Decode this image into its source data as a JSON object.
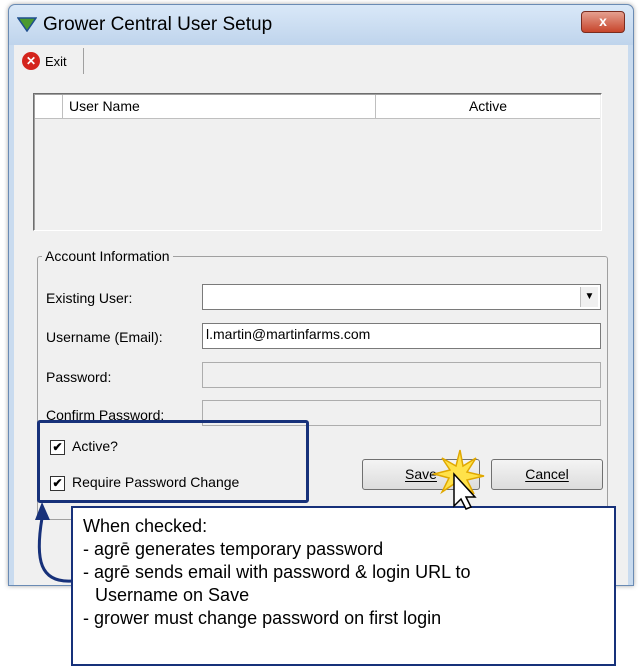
{
  "window": {
    "title": "Grower Central User Setup",
    "close_label": "x"
  },
  "toolbar": {
    "exit_label": "Exit"
  },
  "grid": {
    "columns": [
      "User Name",
      "Active"
    ]
  },
  "account": {
    "group_title": "Account Information",
    "existing_user_label": "Existing User:",
    "existing_user_value": "",
    "username_label": "Username (Email):",
    "username_value": "l.martin@martinfarms.com",
    "password_label": "Password:",
    "confirm_label": "Confirm Password:",
    "active_label": "Active?",
    "active_checked": true,
    "require_pw_label": "Require Password Change",
    "require_pw_checked": true,
    "save_label": "Save",
    "cancel_label": "Cancel"
  },
  "callout": {
    "heading": "When checked:",
    "lines": [
      "- agrē generates temporary password",
      "- agrē sends email with password & login URL to",
      "  Username on Save",
      "- grower must change password on first login"
    ]
  },
  "colors": {
    "accent": "#17317a",
    "window": "#c9dbef",
    "client": "#f0f0f0"
  }
}
